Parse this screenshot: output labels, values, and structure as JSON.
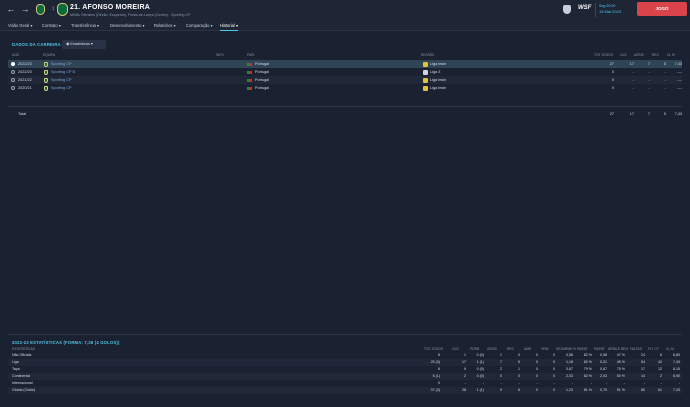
{
  "header": {
    "title": "21. AFONSO MOREIRA",
    "subtitle": "Médio Ofensivo (Direito, Esquerdo), Ponta-de-Lança (Centro) - Sporting CP",
    "wsf": "WSF",
    "time": "Seg 20:00",
    "date": "15 Mai 2023",
    "continue_label": "JOGO"
  },
  "tabs": [
    {
      "label": "Visão Geral"
    },
    {
      "label": "Contrato"
    },
    {
      "label": "Transferência"
    },
    {
      "label": "Desenvolvimento"
    },
    {
      "label": "Relatórios"
    },
    {
      "label": "Comparação"
    },
    {
      "label": "Historial"
    }
  ],
  "career": {
    "title": "DADOS DA CARREIRA",
    "filter_label": "Estatísticas",
    "columns": [
      "ANO",
      "EQUIPA",
      "INFO",
      "PAÍS",
      "DIVISÃO",
      "TOT JOGOS",
      "GLS",
      "ASSIS",
      "REC",
      "CL M"
    ],
    "rows": [
      {
        "year": "2022/23",
        "team": "Sporting CP",
        "info": "",
        "country": "Portugal",
        "division": "Liga bwin",
        "apps": "27",
        "gls": "17",
        "ast": "7",
        "rec": "5",
        "rating": "7,43"
      },
      {
        "year": "2022/23",
        "team": "Sporting CP B",
        "info": "",
        "country": "Portugal",
        "division": "Liga 3",
        "apps": "0",
        "gls": "-",
        "ast": "-",
        "rec": "-",
        "rating": "----"
      },
      {
        "year": "2021/22",
        "team": "Sporting CP",
        "info": "",
        "country": "Portugal",
        "division": "Liga bwin",
        "apps": "0",
        "gls": "-",
        "ast": "-",
        "rec": "-",
        "rating": "----"
      },
      {
        "year": "2020/21",
        "team": "Sporting CP",
        "info": "",
        "country": "Portugal",
        "division": "Liga bwin",
        "apps": "0",
        "gls": "-",
        "ast": "-",
        "rec": "-",
        "rating": "----"
      }
    ],
    "total": {
      "label": "Total",
      "apps": "27",
      "gls": "17",
      "ast": "7",
      "rec": "5",
      "rating": "7,43"
    }
  },
  "season": {
    "title": "2022-23 ESTATÍSTICAS (FORMA: 7,28 (4 GOLOS))",
    "columns": [
      "ESTATÍSTICAS",
      "TOT JOGOS",
      "GLS",
      "PDRB",
      "ASSIS",
      "REC",
      "AMR",
      "VRM",
      "DESARME",
      "% PASSE",
      "PASSE",
      "DRIBLE BEM",
      "FALTAS",
      "FLT CT",
      "CL M"
    ],
    "rows": [
      {
        "name": "Não Oficiais",
        "v": [
          "6",
          "1",
          "0 (0)",
          "1",
          "0",
          "0",
          "0",
          "0,58",
          "82 %",
          "0,58",
          "47 %",
          "24",
          "6",
          "6,80"
        ]
      },
      {
        "name": "Liga",
        "v": [
          "25 (3)",
          "17",
          "1 (1)",
          "7",
          "5",
          "0",
          "0",
          "1,18",
          "82 %",
          "0,31",
          "45 %",
          "54",
          "42",
          "7,43"
        ]
      },
      {
        "name": "Taça",
        "v": [
          "6",
          "9",
          "0 (0)",
          "2",
          "1",
          "0",
          "0",
          "0,67",
          "79 %",
          "0,67",
          "75 %",
          "17",
          "12",
          "8,15"
        ]
      },
      {
        "name": "Continental",
        "v": [
          "6 (1)",
          "2",
          "0 (0)",
          "0",
          "0",
          "0",
          "0",
          "2,03",
          "82 %",
          "2,03",
          "50 %",
          "14",
          "2",
          "6,90"
        ]
      },
      {
        "name": "Internacional",
        "v": [
          "0",
          "-",
          "-",
          "-",
          "-",
          "-",
          "-",
          "-",
          "-",
          "-",
          "-",
          "-",
          "-",
          "-"
        ]
      },
      {
        "name": "Global (Clube)",
        "v": [
          "37 (3)",
          "28",
          "1 (1)",
          "9",
          "6",
          "0",
          "0",
          "1,23",
          "81 %",
          "0,75",
          "51 %",
          "80",
          "61",
          "7,43"
        ]
      }
    ]
  },
  "colors": {
    "accent": "#4fc7e8",
    "primary_button": "#d9434a",
    "background": "#1a2130"
  }
}
